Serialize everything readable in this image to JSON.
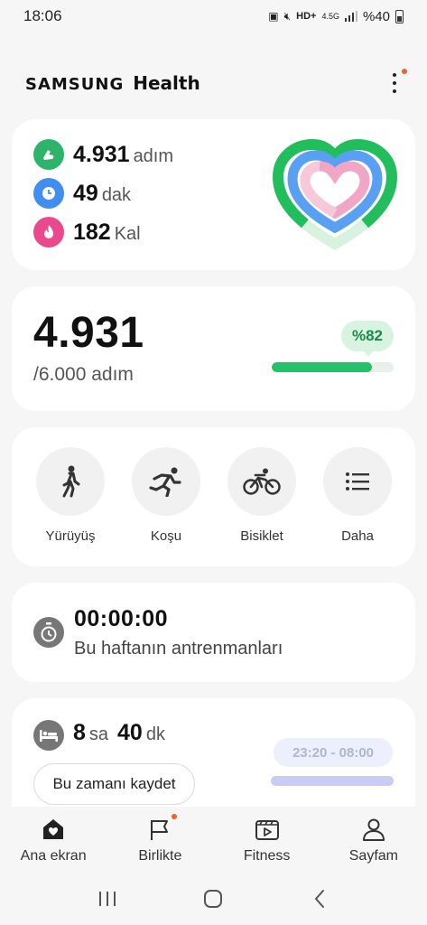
{
  "status_bar": {
    "time": "18:06",
    "network": "4.5G",
    "battery": "%40"
  },
  "header": {
    "brand_samsung": "SAMSUNG",
    "brand_health": "Health",
    "has_notification_dot": true
  },
  "summary": {
    "steps_value": "4.931",
    "steps_unit": "adım",
    "active_value": "49",
    "active_unit": "dak",
    "calories_value": "182",
    "calories_unit": "Kal",
    "colors": {
      "steps": "#2db46a",
      "active": "#3f8ef0",
      "calories": "#ea4a8c"
    }
  },
  "steps_card": {
    "value": "4.931",
    "goal": "/6.000 adım",
    "percent_label": "%82",
    "progress": 0.82
  },
  "activities": [
    {
      "label": "Yürüyüş",
      "icon": "walking-icon"
    },
    {
      "label": "Koşu",
      "icon": "running-icon"
    },
    {
      "label": "Bisiklet",
      "icon": "cycling-icon"
    },
    {
      "label": "Daha",
      "icon": "list-icon"
    }
  ],
  "workout": {
    "timer": "00:00:00",
    "subtitle": "Bu haftanın antrenmanları"
  },
  "sleep": {
    "hours": "8",
    "hours_unit": "sa",
    "minutes": "40",
    "minutes_unit": "dk",
    "time_range": "23:20 - 08:00",
    "save_label": "Bu zamanı kaydet"
  },
  "bottom_nav": [
    {
      "label": "Ana ekran",
      "icon": "home-icon",
      "active": true
    },
    {
      "label": "Birlikte",
      "icon": "flag-icon",
      "badge": true
    },
    {
      "label": "Fitness",
      "icon": "play-video-icon"
    },
    {
      "label": "Sayfam",
      "icon": "person-icon"
    }
  ]
}
